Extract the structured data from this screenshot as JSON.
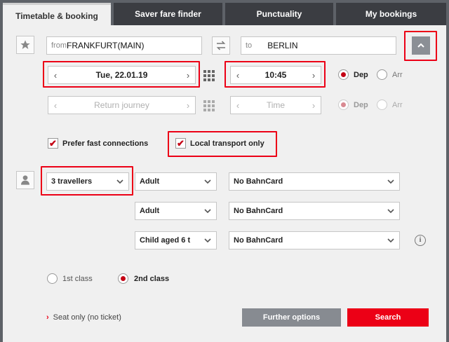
{
  "tabs": [
    {
      "label": "Timetable & booking",
      "active": true
    },
    {
      "label": "Saver fare finder"
    },
    {
      "label": "Punctuality"
    },
    {
      "label": "My bookings"
    }
  ],
  "route": {
    "from_placeholder": "from",
    "from_value": "FRANKFURT(MAIN)",
    "to_placeholder": "to",
    "to_value": "BERLIN"
  },
  "outbound": {
    "date": "Tue, 22.01.19",
    "time": "10:45",
    "dep_label": "Dep",
    "arr_label": "Arr",
    "selected": "Dep"
  },
  "return": {
    "date_placeholder": "Return journey",
    "time_placeholder": "Time",
    "dep_label": "Dep",
    "arr_label": "Arr"
  },
  "options": {
    "prefer_fast": {
      "label": "Prefer fast connections",
      "checked": true
    },
    "local_only": {
      "label": "Local transport only",
      "checked": true
    }
  },
  "travellers": {
    "count_label": "3 travellers",
    "rows": [
      {
        "type": "Adult",
        "card": "No BahnCard"
      },
      {
        "type": "Adult",
        "card": "No BahnCard"
      },
      {
        "type": "Child aged 6 t",
        "card": "No BahnCard"
      }
    ]
  },
  "class": {
    "first": "1st class",
    "second": "2nd class",
    "selected": "2nd class"
  },
  "footer": {
    "seat_only": "Seat only (no ticket)",
    "further_options": "Further options",
    "search": "Search"
  },
  "colors": {
    "accent": "#ec0016",
    "tab_dark": "#3b3d42",
    "panel": "#f0f0f0"
  },
  "icons": [
    "star-icon",
    "swap-icon",
    "collapse-chevron-icon",
    "calendar-icon",
    "person-icon",
    "info-icon"
  ]
}
